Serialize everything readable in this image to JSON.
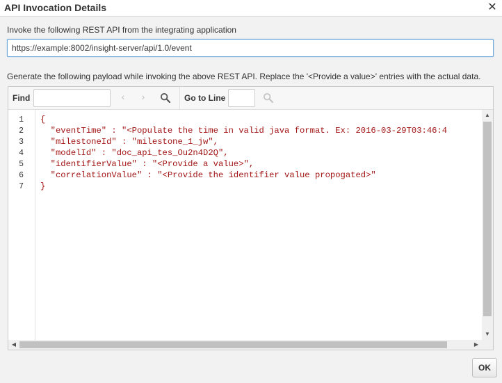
{
  "dialog": {
    "title": "API Invocation Details",
    "close_glyph": "✕",
    "close_icon": "close-icon"
  },
  "invoke": {
    "label": "Invoke the following REST API from the integrating application",
    "url": "https://example:8002/insight-server/api/1.0/event"
  },
  "payload": {
    "label": "Generate the following payload while invoking the above REST API. Replace the '<Provide a value>' entries with the actual data."
  },
  "toolbar": {
    "find_label": "Find",
    "find_value": "",
    "prev_icon": "chevron-left-icon",
    "next_icon": "chevron-right-icon",
    "search_icon": "search-icon",
    "goto_label": "Go to Line",
    "goto_value": "",
    "goto_search_icon": "search-icon"
  },
  "editor": {
    "line_numbers": [
      "1",
      "2",
      "3",
      "4",
      "5",
      "6",
      "7"
    ],
    "lines": [
      "{",
      "  \"eventTime\" : \"<Populate the time in valid java format. Ex: 2016-03-29T03:46:4",
      "  \"milestoneId\" : \"milestone_1_jw\",",
      "  \"modelId\" : \"doc_api_tes_Ou2n4D2Q\",",
      "  \"identifierValue\" : \"<Provide a value>\",",
      "  \"correlationValue\" : \"<Provide the identifier value propogated>\"",
      "}"
    ]
  },
  "footer": {
    "ok_label": "OK"
  },
  "colors": {
    "string": "#a31515",
    "focus_border": "#6fa8dc",
    "background": "#f2f2f2"
  }
}
